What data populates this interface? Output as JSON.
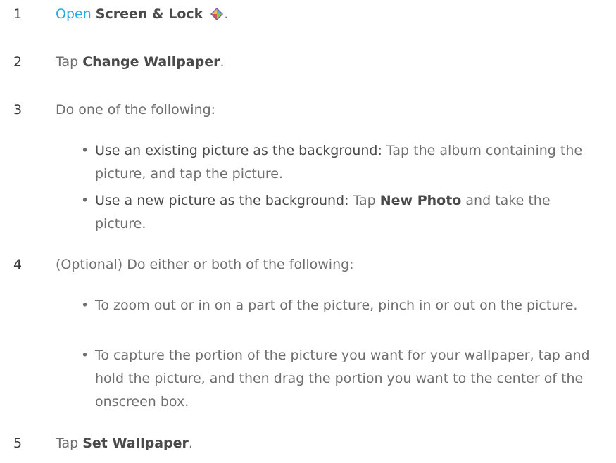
{
  "steps": [
    {
      "num": "1",
      "link": "Open",
      "bold": "Screen & Lock",
      "icon": "screen-lock-app-icon",
      "after": "."
    },
    {
      "num": "2",
      "pre": "Tap ",
      "bold": "Change Wallpaper",
      "after": "."
    },
    {
      "num": "3",
      "text": "Do one of the following:"
    },
    {
      "num": "4",
      "text": "(Optional) Do either or both of the following:"
    },
    {
      "num": "5",
      "pre": "Tap ",
      "bold": "Set Wallpaper",
      "after": "."
    }
  ],
  "step3_bullets": [
    {
      "lead": "Use an existing picture as the background:",
      "text": " Tap the album containing the picture, and tap the picture."
    },
    {
      "lead": "Use a new picture as the background:",
      "pre": " Tap ",
      "bold": "New Photo",
      "after": " and take the picture."
    }
  ],
  "step4_bullets": [
    {
      "text": "To zoom out or in on a part of the picture, pinch in or out on the picture."
    },
    {
      "text": "To capture the portion of the picture you want for your wallpaper, tap and hold the picture, and then drag the portion you want to the center of the onscreen box."
    }
  ],
  "bullet_char": "•",
  "colors": {
    "link": "#27a9e1",
    "text": "#6e6e6e",
    "bold": "#4a4a4a"
  }
}
